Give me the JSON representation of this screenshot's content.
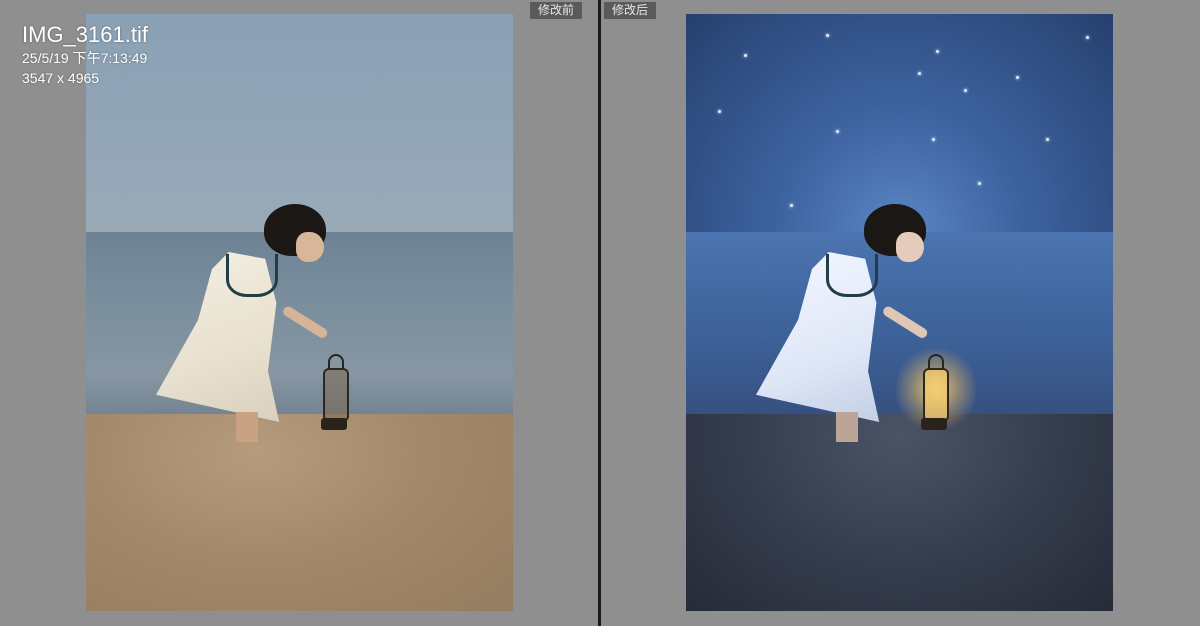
{
  "window": {
    "compare_view": "before-after"
  },
  "before_pane": {
    "label": "修改前"
  },
  "after_pane": {
    "label": "修改后"
  },
  "photo_info": {
    "filename": "IMG_3161.tif",
    "datetime": "25/5/19 下午7:13:49",
    "dimensions": "3547 x 4965"
  },
  "colors": {
    "background": "#8e8e8e",
    "divider": "#1a1a1a",
    "label_bg": "#5a5a5a",
    "label_text": "#e6e6e6"
  }
}
